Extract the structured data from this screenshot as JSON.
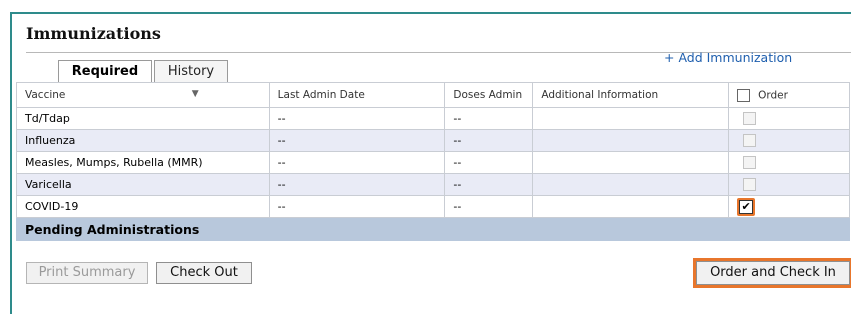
{
  "section": {
    "title": "Immunizations",
    "add_link": "+ Add Immunization"
  },
  "tabs": [
    {
      "label": "Required",
      "active": true
    },
    {
      "label": "History",
      "active": false
    }
  ],
  "table": {
    "headers": {
      "vaccine": "Vaccine",
      "last_admin_date": "Last Admin Date",
      "doses_admin": "Doses Admin",
      "additional_info": "Additional Information",
      "order": "Order"
    },
    "rows": [
      {
        "vaccine": "Td/Tdap",
        "last_admin_date": "--",
        "doses_admin": "--",
        "additional_info": "",
        "order_checked": false
      },
      {
        "vaccine": "Influenza",
        "last_admin_date": "--",
        "doses_admin": "--",
        "additional_info": "",
        "order_checked": false
      },
      {
        "vaccine": "Measles, Mumps, Rubella (MMR)",
        "last_admin_date": "--",
        "doses_admin": "--",
        "additional_info": "",
        "order_checked": false
      },
      {
        "vaccine": "Varicella",
        "last_admin_date": "--",
        "doses_admin": "--",
        "additional_info": "",
        "order_checked": false
      },
      {
        "vaccine": "COVID-19",
        "last_admin_date": "--",
        "doses_admin": "--",
        "additional_info": "",
        "order_checked": true
      }
    ],
    "pending_label": "Pending Administrations"
  },
  "buttons": {
    "print_summary": "Print Summary",
    "check_out": "Check Out",
    "order_and_check_in": "Order and Check In"
  },
  "colors": {
    "accent_border": "#2e8b8b",
    "highlight": "#e8762c",
    "link": "#1f5fae",
    "pending_bar": "#b8c8dc",
    "alt_row": "#e9ebf6"
  }
}
